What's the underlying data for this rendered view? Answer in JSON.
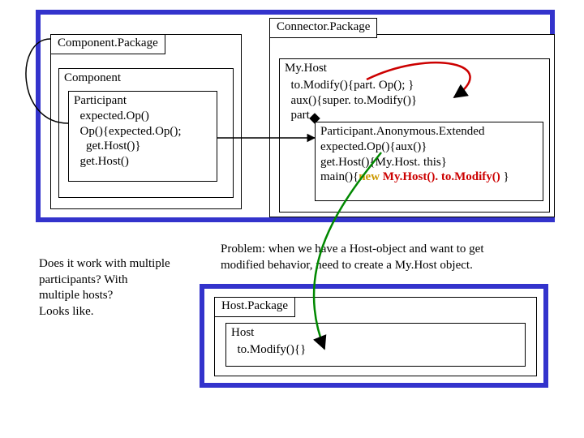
{
  "componentPackage": {
    "title": "Component.Package",
    "component": {
      "title": "Component",
      "participant": {
        "title": "Participant",
        "line1": "  expected.Op()",
        "line2": "  Op(){expected.Op();",
        "line3": "    get.Host()}",
        "line4": "  get.Host()"
      }
    }
  },
  "connectorPackage": {
    "title": "Connector.Package",
    "myHost": {
      "title": "My.Host",
      "line1": "  to.Modify(){part. Op(); }",
      "line2": "  aux(){super. to.Modify()}",
      "partLabel": "  part",
      "pae": {
        "title": "Participant.Anonymous.Extended",
        "line1": "expected.Op(){aux()}",
        "line2": "get.Host(){My.Host. this}",
        "mainPrefix": "main(){",
        "mainNew": "new",
        "mainCall": " My.Host(). to.Modify()",
        "mainSuffix": " }"
      }
    }
  },
  "problem": {
    "line1": "Problem: when we have a Host-object and want to get",
    "line2": "modified behavior, need to create a My.Host object."
  },
  "question": {
    "line1": "Does it work with multiple",
    "line2": "participants? With",
    "line3": "multiple hosts?",
    "line4": "Looks like."
  },
  "hostPackage": {
    "title": "Host.Package",
    "host": {
      "title": "Host",
      "line1": "  to.Modify(){}"
    }
  }
}
